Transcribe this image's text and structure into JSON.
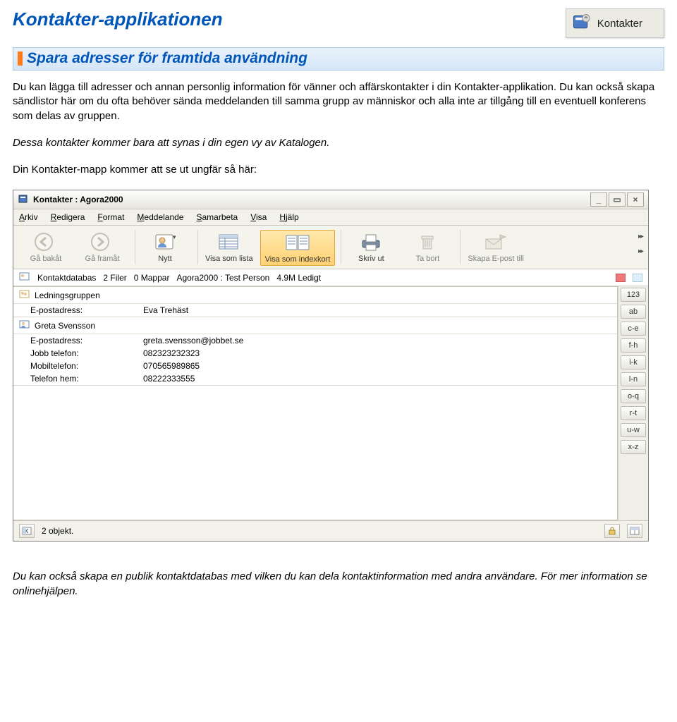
{
  "page": {
    "title": "Kontakter-applikationen",
    "badge_label": "Kontakter",
    "section_heading": "Spara adresser för framtida användning",
    "para1": "Du kan lägga till adresser och annan personlig information för vänner och affärskontakter i din Kontakter-applikation. Du kan också skapa sändlistor här om du ofta behöver sända meddelanden till samma grupp av människor och alla inte ar tillgång till en eventuell konferens som delas av gruppen.",
    "para2": "Dessa kontakter kommer bara att synas i din egen vy av Katalogen.",
    "para3": "Din Kontakter-mapp kommer att se ut ungfär så här:",
    "footer": "Du kan också skapa en publik kontaktdatabas med vilken du kan dela kontaktinformation med andra användare. För mer information se onlinehjälpen."
  },
  "app": {
    "window_title": "Kontakter : Agora2000",
    "menus": [
      "Arkiv",
      "Redigera",
      "Format",
      "Meddelande",
      "Samarbeta",
      "Visa",
      "Hjälp"
    ],
    "toolbar": {
      "back": "Gå bakåt",
      "forward": "Gå framåt",
      "new": "Nytt",
      "view_list": "Visa som lista",
      "view_index": "Visa som indexkort",
      "print": "Skriv ut",
      "delete": "Ta bort",
      "compose": "Skapa E-post till"
    },
    "infobar": {
      "db": "Kontaktdatabas",
      "files": "2 Filer",
      "folders": "0 Mappar",
      "owner": "Agora2000 : Test Person",
      "free": "4.9M Ledigt"
    },
    "cards": [
      {
        "name": "Ledningsgruppen",
        "type": "group",
        "rows": [
          {
            "k": "E-postadress:",
            "v": "Eva Trehäst"
          }
        ]
      },
      {
        "name": "Greta Svensson",
        "type": "person",
        "rows": [
          {
            "k": "E-postadress:",
            "v": "greta.svensson@jobbet.se"
          },
          {
            "k": "Jobb telefon:",
            "v": "082323232323"
          },
          {
            "k": "Mobiltelefon:",
            "v": "070565989865"
          },
          {
            "k": "Telefon hem:",
            "v": "08222333555"
          }
        ]
      }
    ],
    "alpha_tabs": [
      "123",
      "ab",
      "c-e",
      "f-h",
      "i-k",
      "l-n",
      "o-q",
      "r-t",
      "u-w",
      "x-z"
    ],
    "status": "2 objekt."
  }
}
